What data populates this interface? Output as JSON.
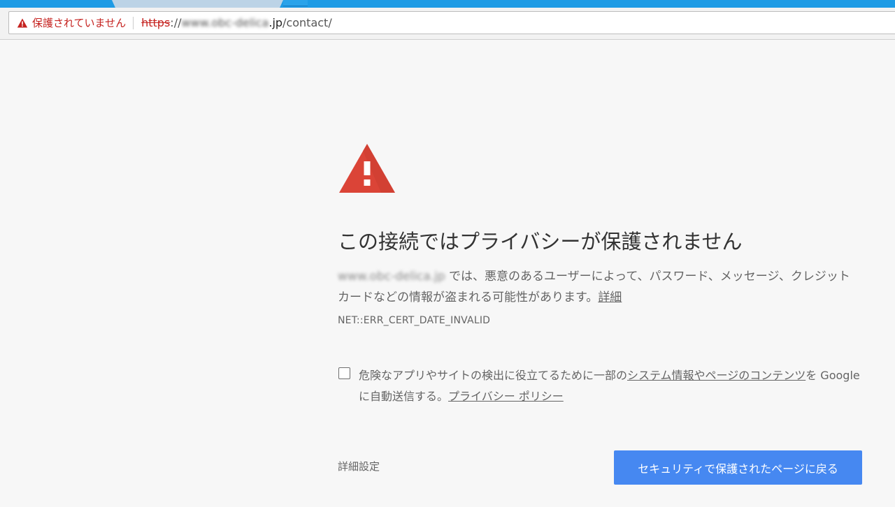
{
  "omnibox": {
    "security_icon": "warning-triangle-icon",
    "security_label": "保護されていません",
    "url_scheme": "https",
    "url_separator": "://",
    "url_host_blurred": "www.obc-delica",
    "url_host_visible": ".jp",
    "url_path": "/contact/"
  },
  "interstitial": {
    "icon": "error-triangle-icon",
    "heading": "この接続ではプライバシーが保護されません",
    "site_host_blurred": "www.obc-delica.jp",
    "body": " では、悪意のあるユーザーによって、パスワード、メッセージ、クレジット カードなどの情報が盗まれる可能性があります。",
    "details_link": "詳細",
    "error_code": "NET::ERR_CERT_DATE_INVALID",
    "optin": {
      "checked": false,
      "text_before": "危険なアプリやサイトの検出に役立てるために一部の",
      "link_system_info": "システム情報やページのコンテンツ",
      "text_middle": "を Google に自動送信する。",
      "link_privacy": "プライバシー ポリシー"
    },
    "advanced_label": "詳細設定",
    "back_button_label": "セキュリティで保護されたページに戻る"
  },
  "colors": {
    "error_red": "#db4437",
    "primary_blue": "#4688f1",
    "insecure_red": "#c5221f",
    "tab_strip_blue": "#1e9be5"
  }
}
